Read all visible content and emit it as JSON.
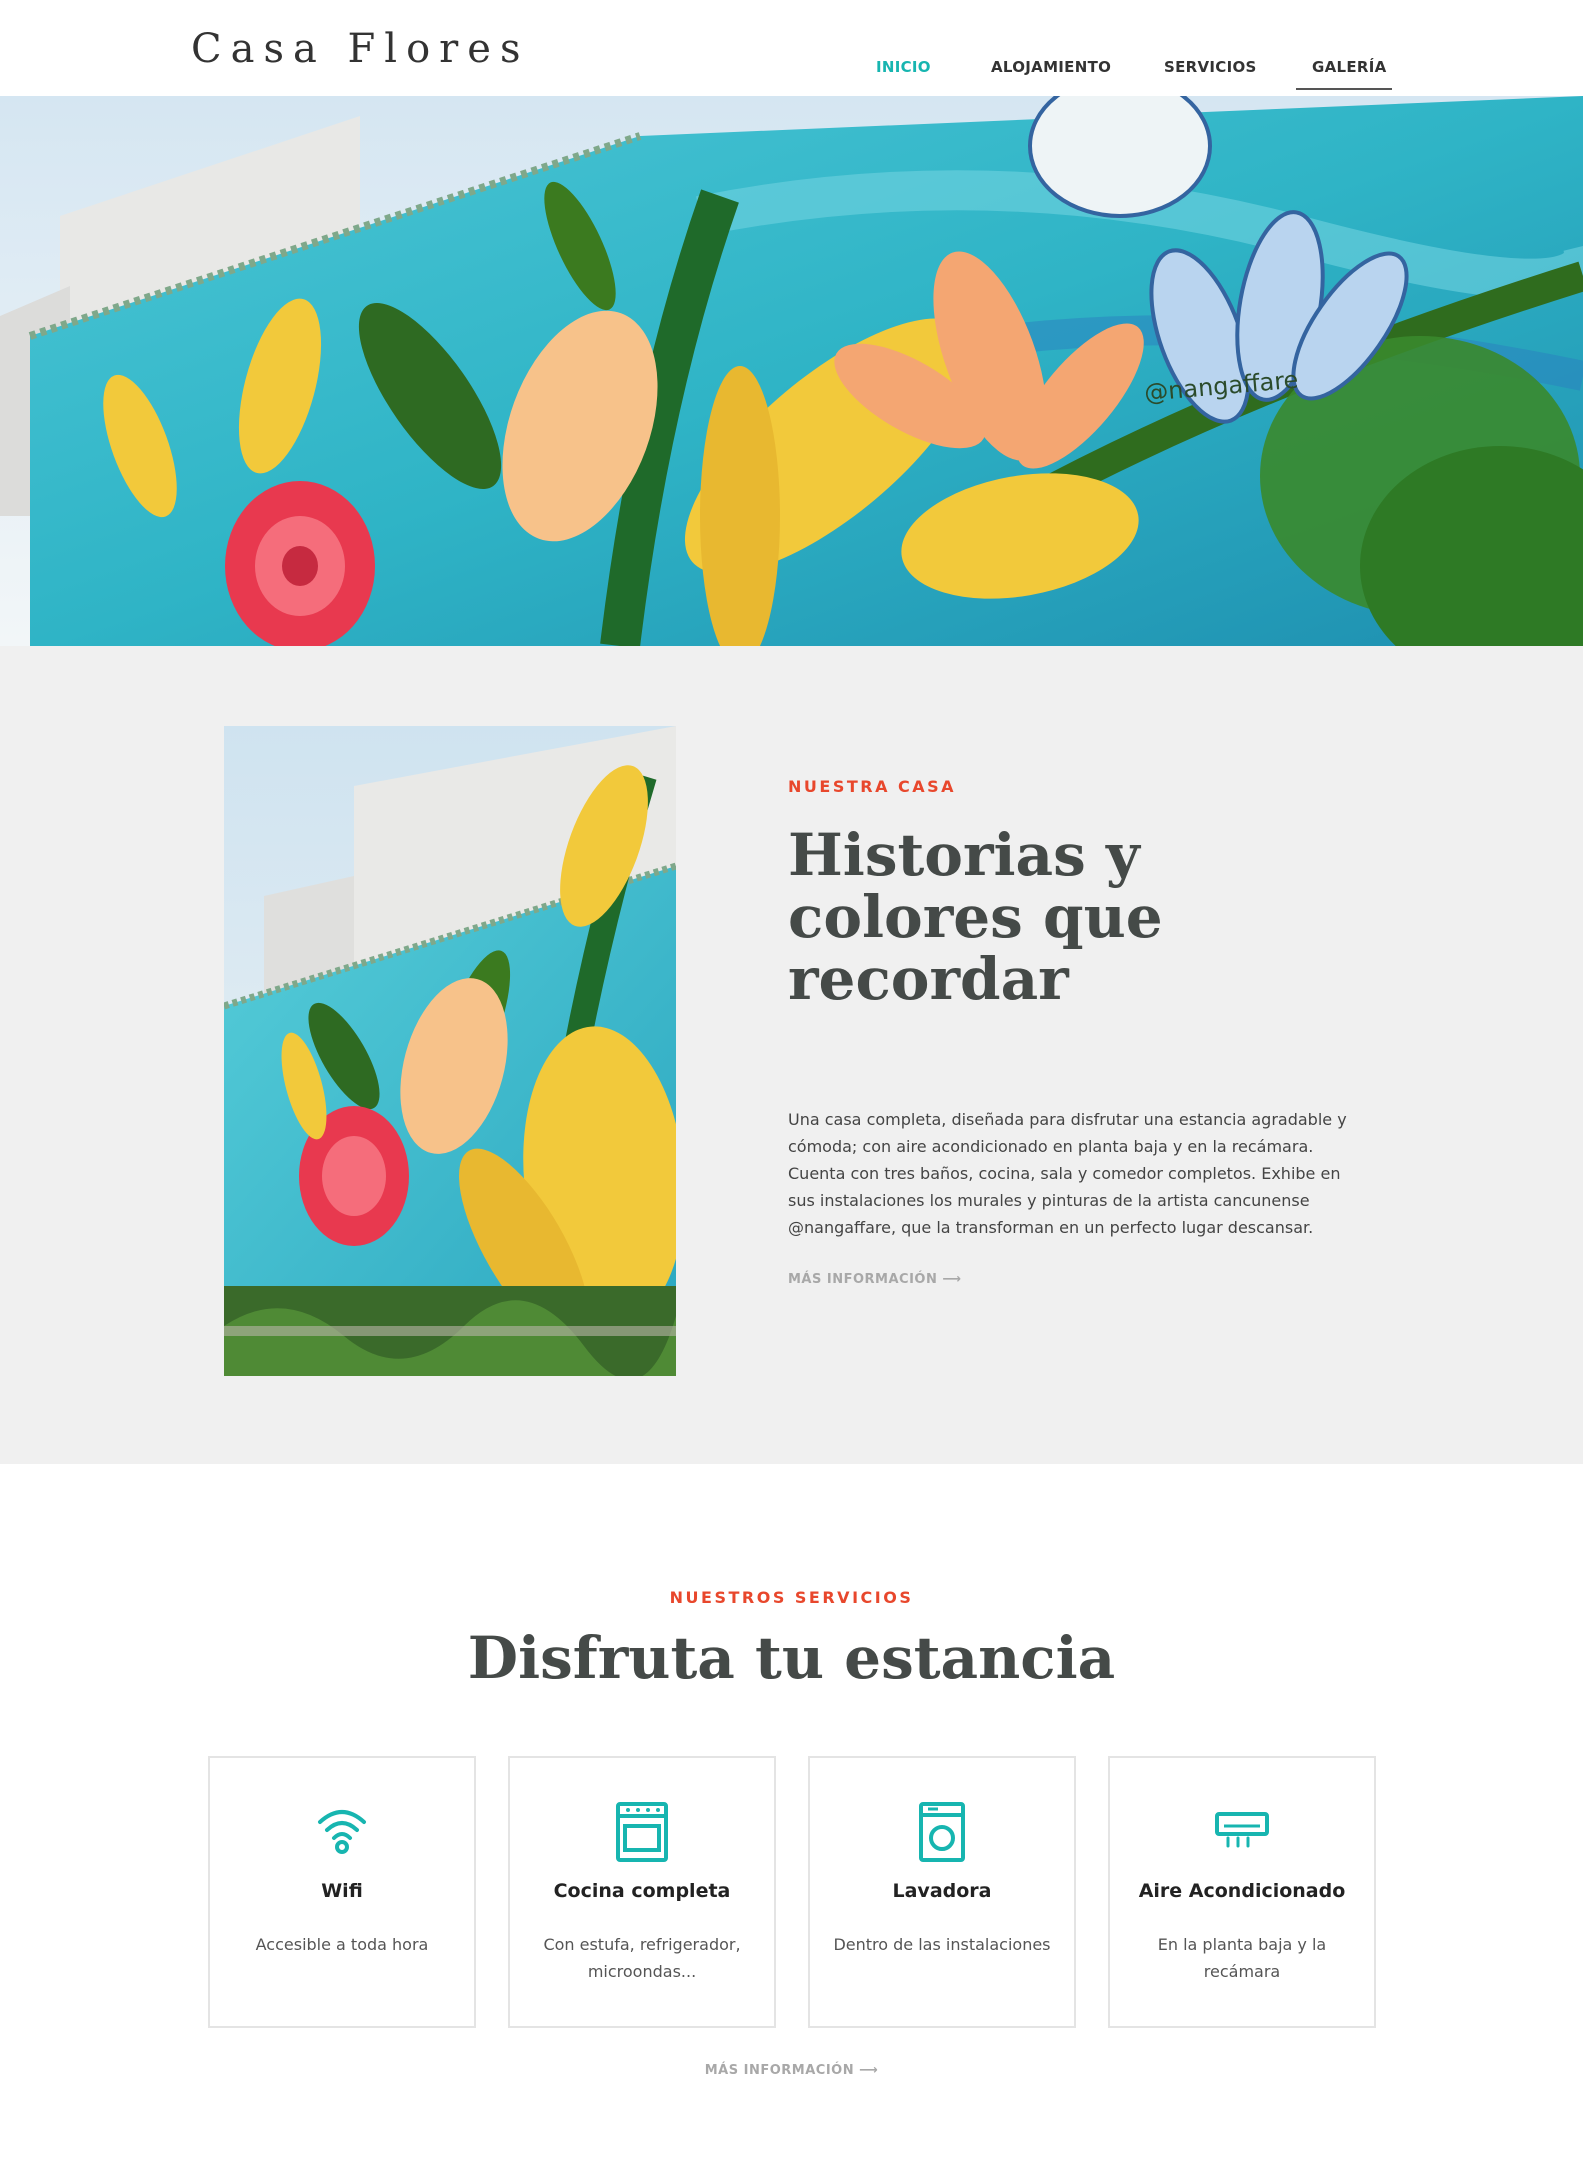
{
  "header": {
    "logo": "Casa Flores",
    "nav": [
      {
        "label": "INICIO",
        "active": true
      },
      {
        "label": "ALOJAMIENTO",
        "active": false
      },
      {
        "label": "SERVICIOS",
        "active": false
      },
      {
        "label": "GALERÍA",
        "active": false
      }
    ]
  },
  "hero": {
    "watermark": "@nangaffare"
  },
  "about": {
    "eyebrow": "NUESTRA CASA",
    "title": "Historias y colores que recordar",
    "text": "Una casa completa, diseñada para disfrutar una estancia agradable y cómoda; con aire acondicionado en planta baja y en la recámara. Cuenta con tres baños, cocina, sala y comedor completos. Exhibe en sus instalaciones los murales y pinturas de la artista cancunense @nangaffare, que la transforman en un perfecto lugar descansar.",
    "more": "MÁS INFORMACIÓN ⟶"
  },
  "services": {
    "eyebrow": "NUESTROS SERVICIOS",
    "title": "Disfruta tu estancia",
    "cards": [
      {
        "icon": "wifi-icon",
        "title": "Wifi",
        "desc": "Accesible a toda hora"
      },
      {
        "icon": "stove-icon",
        "title": "Cocina completa",
        "desc": "Con estufa, refrigerador, microondas..."
      },
      {
        "icon": "washing-machine-icon",
        "title": "Lavadora",
        "desc": "Dentro de las instalaciones"
      },
      {
        "icon": "air-conditioner-icon",
        "title": "Aire Acondicionado",
        "desc": "En la planta baja y la recámara"
      }
    ],
    "more": "MÁS INFORMACIÓN ⟶"
  },
  "colors": {
    "accent_teal": "#17b5b0",
    "eyebrow_red": "#e8472c",
    "heading": "#454a48",
    "section_bg": "#f0f0f0"
  }
}
